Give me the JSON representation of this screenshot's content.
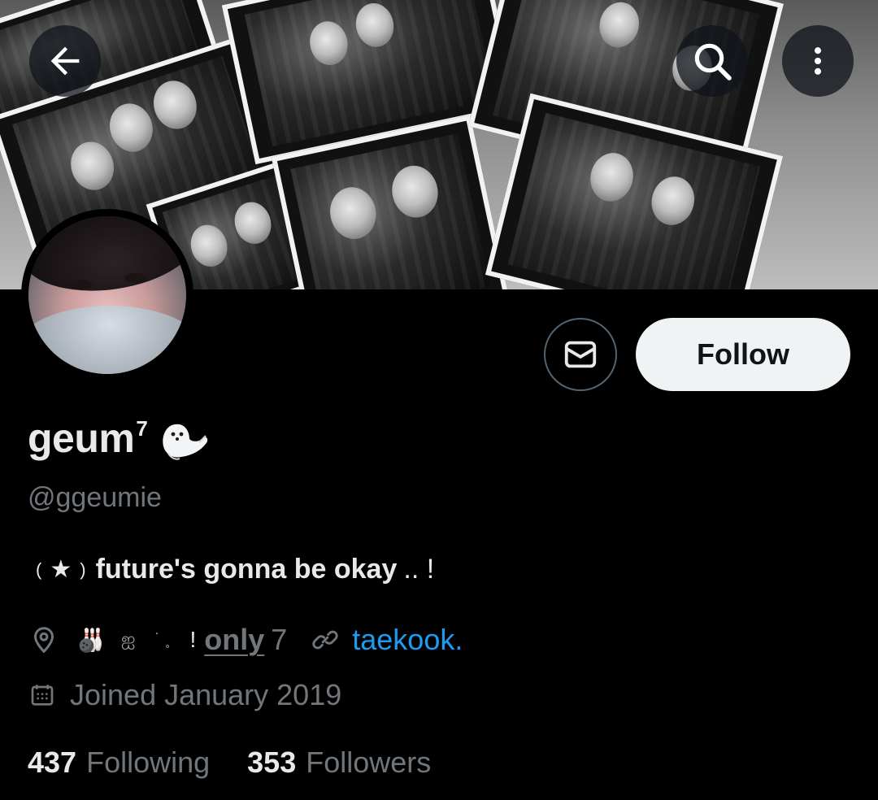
{
  "header": {
    "back_icon": "arrow-left-icon",
    "search_icon": "search-icon",
    "more_icon": "more-vertical-icon"
  },
  "actions": {
    "message_icon": "mail-icon",
    "follow_label": "Follow"
  },
  "profile": {
    "display_name": "geum",
    "display_name_superscript": "7",
    "display_name_emoji": "seal",
    "handle": "@ggeumie",
    "bio": {
      "open": "(",
      "star": "★",
      "close": ")",
      "text": "future's gonna be okay",
      "tail": ".. !"
    },
    "location": {
      "icon": "location-pin-icon",
      "emoji": "🎳",
      "char": "ஐ",
      "dots": "˙ ˳",
      "bang": "!",
      "only": "only",
      "seven": "7"
    },
    "website": {
      "icon": "link-icon",
      "text": "taekook."
    },
    "joined": {
      "icon": "calendar-icon",
      "text": "Joined January 2019"
    },
    "stats": {
      "following_count": "437",
      "following_label": "Following",
      "followers_count": "353",
      "followers_label": "Followers"
    }
  },
  "colors": {
    "background": "#000000",
    "text_primary": "#e7e9ea",
    "text_secondary": "#71767b",
    "link": "#1d9bf0",
    "follow_button_bg": "#eff3f4",
    "outline": "#536471"
  }
}
